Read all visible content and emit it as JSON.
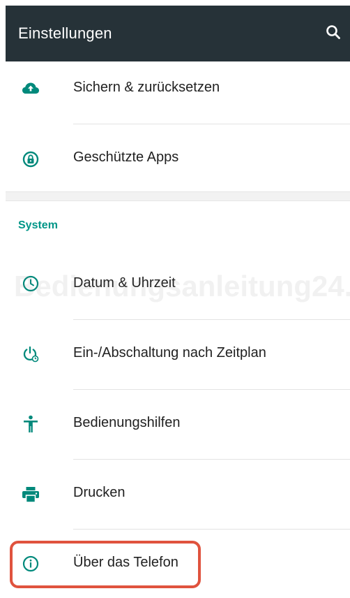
{
  "app_bar": {
    "title": "Einstellungen",
    "search_icon": "search-icon"
  },
  "colors": {
    "app_bar_bg": "#263238",
    "accent": "#009688",
    "highlight": "#e0533e"
  },
  "settings_list": {
    "items_top": [
      {
        "label": "Sichern & zurücksetzen",
        "icon": "cloud-upload-icon"
      },
      {
        "label": "Geschützte Apps",
        "icon": "lock-icon"
      }
    ],
    "system_section": {
      "header": "System",
      "items": [
        {
          "label": "Datum & Uhrzeit",
          "icon": "clock-icon"
        },
        {
          "label": "Ein-/Abschaltung nach Zeitplan",
          "icon": "power-schedule-icon"
        },
        {
          "label": "Bedienungshilfen",
          "icon": "accessibility-icon"
        },
        {
          "label": "Drucken",
          "icon": "printer-icon"
        },
        {
          "label": "Über das Telefon",
          "icon": "info-icon"
        }
      ]
    }
  },
  "watermark": "Bedienungsanleitung24.de"
}
